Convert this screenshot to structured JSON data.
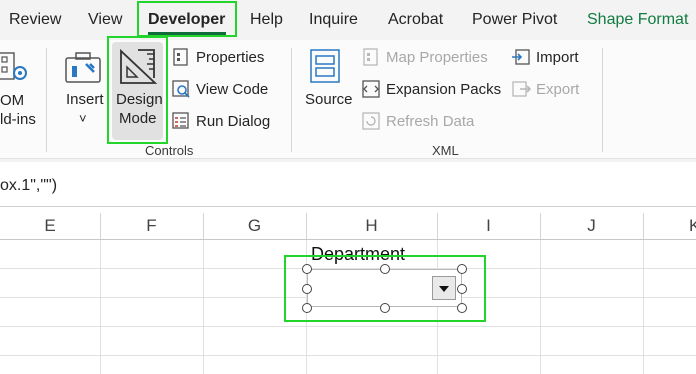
{
  "ribbon_tabs": [
    "Review",
    "View",
    "Developer",
    "Help",
    "Inquire",
    "Acrobat",
    "Power Pivot",
    "Shape Format"
  ],
  "active_tab": "Developer",
  "addins": {
    "label_line1": "OM",
    "label_line2": "ld-ins"
  },
  "controls_group": {
    "insert_label": "Insert",
    "insert_arrow": "˅",
    "design_mode_line1": "Design",
    "design_mode_line2": "Mode",
    "properties": "Properties",
    "view_code": "View Code",
    "run_dialog": "Run Dialog",
    "group_label": "Controls"
  },
  "xml_group": {
    "source": "Source",
    "map_properties": "Map Properties",
    "expansion_packs": "Expansion Packs",
    "refresh_data": "Refresh Data",
    "import": "Import",
    "export": "Export",
    "group_label": "XML"
  },
  "formula_bar": {
    "text": "ox.1\",\"\")"
  },
  "columns": [
    "E",
    "F",
    "G",
    "H",
    "I",
    "J",
    "K"
  ],
  "combo": {
    "label": "Department"
  },
  "colors": {
    "accent_green": "#22d52a",
    "shape_format": "#107c41",
    "tab_underline": "#0f6c3a"
  }
}
